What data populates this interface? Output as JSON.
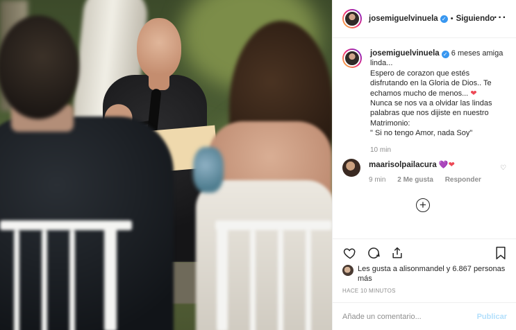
{
  "post": {
    "username": "josemiguelvinuela",
    "follow_status": "Siguiendo",
    "separator": "•",
    "more_icon": "more-horizontal-icon"
  },
  "caption": {
    "username": "josemiguelvinuela",
    "text_l1": "6 meses amiga linda...",
    "text_l2": "Espero de corazon que estés disfrutando en la Gloria de Dios.. Te echamos mucho de menos...",
    "heart": "❤",
    "text_l3": "Nunca se nos va a olvidar las lindas palabras que nos dijiste en nuestro Matrimonio:",
    "text_l4": "\" Si no tengo Amor, nada Soy\"",
    "time": "10 min"
  },
  "comment": {
    "username": "maarisolpailacura",
    "purple_heart": "💜",
    "red_heart": "❤",
    "time": "9 min",
    "likes": "2 Me gusta",
    "reply": "Responder"
  },
  "actions": {
    "likes_text": "Les gusta a alisonmandel y 6.867 personas más",
    "timestamp": "HACE 10 MINUTOS",
    "comment_placeholder": "Añade un comentario...",
    "publish": "Publicar"
  },
  "colors": {
    "verified": "#3897f0",
    "heart": "#ed4956",
    "meta": "#8e8e8e",
    "publish_disabled": "#b2dffc"
  }
}
